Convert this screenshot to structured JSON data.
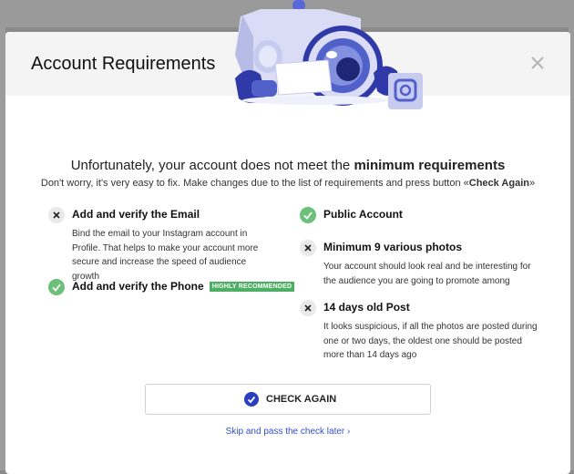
{
  "modal": {
    "title": "Account Requirements",
    "close_icon": "close-icon"
  },
  "message": {
    "headline_prefix": "Unfortunately, your account does not meet the ",
    "headline_bold": "minimum requirements",
    "sub_prefix": "Don't worry, it's very easy to fix. Make changes due to the list of requirements and press button «",
    "sub_bold": "Check Again",
    "sub_suffix": "»"
  },
  "requirements": {
    "email": {
      "status": "fail",
      "icon": "close-icon",
      "title": "Add and verify the Email",
      "description": "Bind the email to your Instagram account in Profile. That helps to make your account more secure and increase the speed of audience growth"
    },
    "phone": {
      "status": "ok",
      "icon": "check-icon",
      "title": "Add and verify the Phone",
      "badge": "HIGHLY RECOMMENDED"
    },
    "public": {
      "status": "ok",
      "icon": "check-icon",
      "title": "Public Account"
    },
    "photos": {
      "status": "fail",
      "icon": "close-icon",
      "title": "Minimum 9 various photos",
      "description": "Your account should look real and be interesting for the audience you are going to promote among"
    },
    "post_age": {
      "status": "fail",
      "icon": "close-icon",
      "title": "14 days old Post",
      "description": "It looks suspicious, if all the photos are posted during one or two days, the oldest one should be posted more than 14 days ago"
    }
  },
  "actions": {
    "check_again_label": "CHECK AGAIN",
    "skip_label": "Skip and pass the check later ›"
  },
  "colors": {
    "success": "#6cc07a",
    "badge": "#4caf64",
    "accent": "#2a3fc0",
    "link": "#3550c8",
    "fail_bg": "#e9e9e9"
  }
}
